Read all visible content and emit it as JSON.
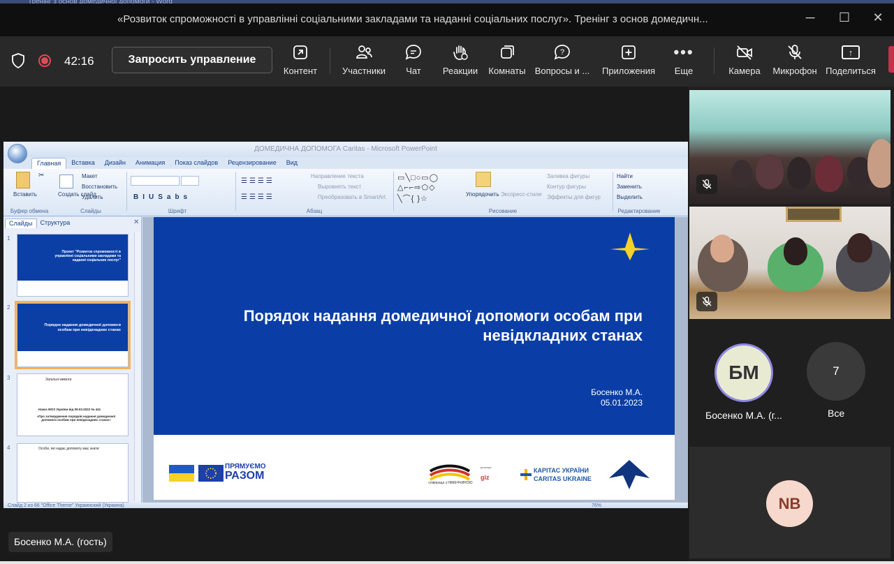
{
  "window": {
    "title": "«Розвиток спроможності в управлінні соціальними закладами та наданні соціальних послуг». Тренінг з основ домедичн...",
    "top_strip_text": "Тренінг з основ домедичної допомоги - Word"
  },
  "toolbar": {
    "timer": "42:16",
    "request_control": "Запросить управление",
    "items": [
      {
        "label": "Контент",
        "icon": "content-share-icon"
      },
      {
        "label": "Участники",
        "icon": "people-icon"
      },
      {
        "label": "Чат",
        "icon": "chat-icon"
      },
      {
        "label": "Реакции",
        "icon": "raised-hand-icon"
      },
      {
        "label": "Комнаты",
        "icon": "breakout-rooms-icon"
      },
      {
        "label": "Вопросы и ...",
        "icon": "qa-icon"
      },
      {
        "label": "Приложения",
        "icon": "apps-plus-icon"
      },
      {
        "label": "Еще",
        "icon": "more-dots-icon"
      },
      {
        "label": "Камера",
        "icon": "camera-off-icon"
      },
      {
        "label": "Микрофон",
        "icon": "mic-off-icon"
      },
      {
        "label": "Поделиться",
        "icon": "share-screen-icon"
      }
    ],
    "more_glyph": "•••",
    "share_glyph": "↑"
  },
  "ppt": {
    "title": "ДОМЕДИЧНА ДОПОМОГА Caritas - Microsoft PowerPoint",
    "tabs": [
      "Главная",
      "Вставка",
      "Дизайн",
      "Анимация",
      "Показ слайдов",
      "Рецензирование",
      "Вид"
    ],
    "ribbon": {
      "paste": "Вставить",
      "create_slide": "Создать слайд",
      "layout": "Макет",
      "restore": "Восстановить",
      "delete": "Удалить",
      "text_direction": "Направление текста",
      "align_text": "Выровнять текст",
      "smartart": "Преобразовать в SmartArt",
      "arrange": "Упорядочить",
      "quick_styles": "Экспресс-стили",
      "shape_fill": "Заливка фигуры",
      "shape_outline": "Контур фигуры",
      "shape_effects": "Эффекты для фигур",
      "find": "Найти",
      "replace": "Заменить",
      "select": "Выделить",
      "groups": [
        "Буфер обмена",
        "Слайды",
        "Шрифт",
        "Абзац",
        "Рисование",
        "Редактирование"
      ]
    },
    "panel_tabs": [
      "Слайды",
      "Структура"
    ],
    "panel_close": "✕",
    "thumbs": [
      {
        "num": "1",
        "title": "Проект \"Розвиток спроможності в управлінні соціальними закладами та наданні соціальних послуг\""
      },
      {
        "num": "2",
        "title": "Порядок надання домедичної допомоги особам при невідкладних станах"
      },
      {
        "num": "3",
        "title": "Загальні вимоги",
        "subtitle": "«Про затвердження порядків надання домедичної допомоги особам при невідкладних станах»",
        "body": "Наказ МОЗ України від 09.03.2022 № 441"
      },
      {
        "num": "4",
        "title": "Особи, які надає допомогу має знати:"
      }
    ],
    "slide": {
      "title": "Порядок надання домедичної допомоги особам при невідкладних станах",
      "author": "Босенко М.А.",
      "date": "05.01.2023",
      "together_small": "ПРЯМУЄМО",
      "together_big": "РАЗОМ",
      "coop_text": "співпраця з НІМЕЧЧИНОЮ",
      "giz": "giz",
      "giz_small": "реалізує",
      "caritas_ua": "КАРІТАС УКРАЇНИ",
      "caritas_en": "CARITAS UKRAINE"
    },
    "status": "Слайд 2 из 66    \"Office Theme\"    Украинский (Украина)",
    "zoom": "76%"
  },
  "participants": {
    "bm_initials": "БМ",
    "bm_name": "Босенко М.А. (г...",
    "more_count": "7",
    "more_label": "Все",
    "nb_initials": "NB",
    "speaker_tag": "Босенко М.А. (гость)"
  },
  "colors": {
    "slide_blue": "#0a3ea6",
    "star_yellow": "#f5d12a",
    "record_red": "#e04a55",
    "avatar_ring": "#8f88e0"
  }
}
